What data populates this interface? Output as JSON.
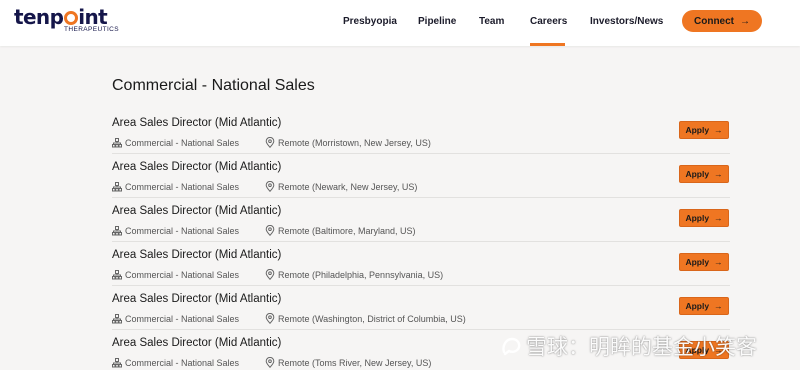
{
  "header": {
    "logo_text": "tenpoint",
    "logo_subtext": "THERAPEUTICS",
    "nav": [
      "Presbyopia",
      "Pipeline",
      "Team",
      "Careers",
      "Investors/News"
    ],
    "active_nav": "Careers",
    "connect_label": "Connect",
    "accent": "#ef7622"
  },
  "section": {
    "title": "Commercial - National Sales"
  },
  "jobs": [
    {
      "title": "Area Sales Director (Mid Atlantic)",
      "department": "Commercial - National Sales",
      "location": "Remote (Morristown, New Jersey, US)",
      "apply_label": "Apply"
    },
    {
      "title": "Area Sales Director (Mid Atlantic)",
      "department": "Commercial - National Sales",
      "location": "Remote (Newark, New Jersey, US)",
      "apply_label": "Apply"
    },
    {
      "title": "Area Sales Director (Mid Atlantic)",
      "department": "Commercial - National Sales",
      "location": "Remote (Baltimore, Maryland, US)",
      "apply_label": "Apply"
    },
    {
      "title": "Area Sales Director (Mid Atlantic)",
      "department": "Commercial - National Sales",
      "location": "Remote (Philadelphia, Pennsylvania, US)",
      "apply_label": "Apply"
    },
    {
      "title": "Area Sales Director (Mid Atlantic)",
      "department": "Commercial - National Sales",
      "location": "Remote (Washington, District of Columbia, US)",
      "apply_label": "Apply"
    },
    {
      "title": "Area Sales Director (Mid Atlantic)",
      "department": "Commercial - National Sales",
      "location": "Remote (Toms River, New Jersey, US)",
      "apply_label": "Apply"
    }
  ],
  "watermark": "雪球：明眸的基金小笑客"
}
